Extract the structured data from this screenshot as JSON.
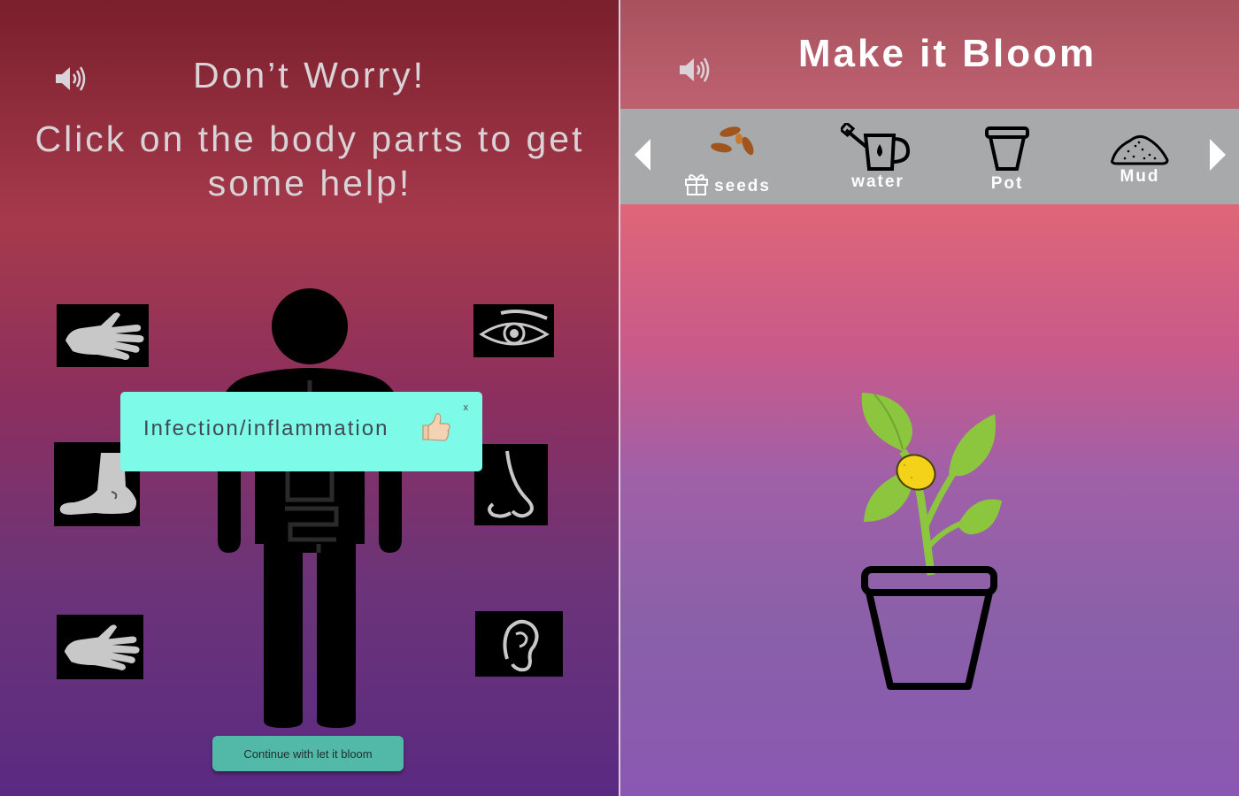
{
  "left_screen": {
    "title": "Don’t Worry!",
    "subtitle": "Click on the body parts to get some help!",
    "speaker_icon": "speaker-volume-icon",
    "body_parts": [
      {
        "name": "hand",
        "icon": "hand-icon"
      },
      {
        "name": "foot",
        "icon": "foot-icon"
      },
      {
        "name": "hand",
        "icon": "hand-icon"
      },
      {
        "name": "eye",
        "icon": "eye-icon"
      },
      {
        "name": "nose",
        "icon": "nose-icon"
      },
      {
        "name": "ear",
        "icon": "ear-icon"
      }
    ],
    "popup": {
      "text": "Infection/inflammation",
      "emoji_icon": "thumbs-up-icon",
      "close_label": "x"
    },
    "continue_button": "Continue with let it bloom"
  },
  "right_screen": {
    "title": "Make it Bloom",
    "speaker_icon": "speaker-volume-icon",
    "toolbar": {
      "items": [
        {
          "label": "seeds",
          "icon": "seeds-icon"
        },
        {
          "label": "water",
          "icon": "watering-can-icon"
        },
        {
          "label": "Pot",
          "icon": "pot-icon"
        },
        {
          "label": "Mud",
          "icon": "mud-pile-icon"
        }
      ]
    },
    "plant_icon": "potted-lemon-plant-icon"
  },
  "colors": {
    "popup_bg": "#7dfbe8",
    "button_bg": "#52b9a8",
    "toolbar_bg": "#a7a9ab",
    "leaf_green": "#8cc63f",
    "lemon_yellow": "#f5d21a"
  }
}
